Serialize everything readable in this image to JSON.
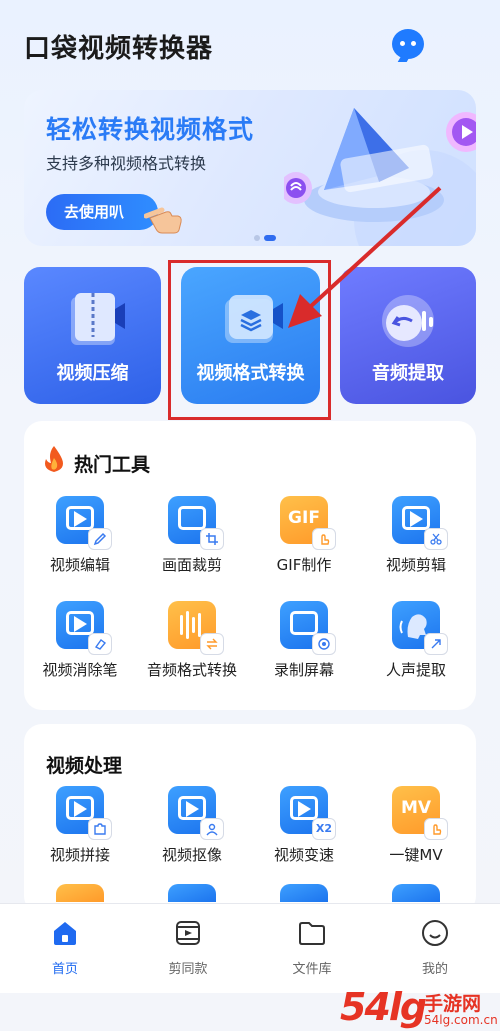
{
  "header": {
    "title": "口袋视频转换器",
    "icon": "message-bubble-icon",
    "accent": "#1f7bff"
  },
  "banner": {
    "title": "轻松转换视频格式",
    "subtitle": "支持多种视频格式转换",
    "button_label": "去使用叭",
    "pages": 2,
    "active_page": 2
  },
  "features": [
    {
      "label": "视频压缩",
      "icon": "zip-video-icon"
    },
    {
      "label": "视频格式转换",
      "icon": "format-layers-icon",
      "highlighted": true
    },
    {
      "label": "音频提取",
      "icon": "audio-extract-icon"
    }
  ],
  "hot_tools": {
    "title": "热门工具",
    "items": [
      {
        "label": "视频编辑",
        "icon": "video-edit-icon",
        "color": "blue"
      },
      {
        "label": "画面裁剪",
        "icon": "crop-icon",
        "color": "blue"
      },
      {
        "label": "GIF制作",
        "icon": "gif-icon",
        "color": "orange",
        "icon_text": "GIF"
      },
      {
        "label": "视频剪辑",
        "icon": "video-cut-icon",
        "color": "blue"
      },
      {
        "label": "视频消除笔",
        "icon": "eraser-icon",
        "color": "blue"
      },
      {
        "label": "音频格式转换",
        "icon": "audio-convert-icon",
        "color": "orange"
      },
      {
        "label": "录制屏幕",
        "icon": "screen-record-icon",
        "color": "blue"
      },
      {
        "label": "人声提取",
        "icon": "voice-extract-icon",
        "color": "blue"
      }
    ]
  },
  "video_processing": {
    "title": "视频处理",
    "items": [
      {
        "label": "视频拼接",
        "icon": "video-merge-icon",
        "color": "blue"
      },
      {
        "label": "视频抠像",
        "icon": "video-matting-icon",
        "color": "blue"
      },
      {
        "label": "视频变速",
        "icon": "video-speed-icon",
        "color": "blue",
        "badge_text": "X2"
      },
      {
        "label": "一键MV",
        "icon": "mv-icon",
        "color": "orange",
        "icon_text": "MV"
      }
    ]
  },
  "tabbar": [
    {
      "label": "首页",
      "icon": "home-icon",
      "active": true
    },
    {
      "label": "剪同款",
      "icon": "template-icon",
      "active": false
    },
    {
      "label": "文件库",
      "icon": "folder-icon",
      "active": false
    },
    {
      "label": "我的",
      "icon": "smile-icon",
      "active": false
    }
  ],
  "watermark": {
    "logo": "54lg",
    "text": "手游网",
    "sub": "54lg.com.cn"
  },
  "colors": {
    "primary": "#2a7bf6",
    "highlight_box": "#d92b2b",
    "orange": "#ff9a2a"
  }
}
